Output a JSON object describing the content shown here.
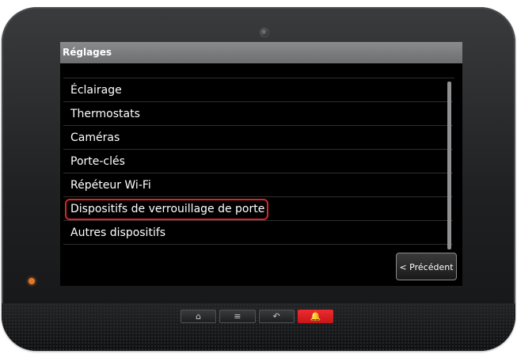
{
  "screen": {
    "title": "Réglages",
    "items": [
      {
        "label": "Éclairage"
      },
      {
        "label": "Thermostats"
      },
      {
        "label": "Caméras"
      },
      {
        "label": "Porte-clés"
      },
      {
        "label": "Répéteur Wi-Fi"
      },
      {
        "label": "Dispositifs de verrouillage de porte",
        "highlighted": true
      },
      {
        "label": "Autres dispositifs"
      }
    ],
    "back_label": "< Précédent"
  },
  "hardware_buttons": [
    {
      "icon": "home-icon",
      "glyph": "⌂"
    },
    {
      "icon": "menu-icon",
      "glyph": "≡"
    },
    {
      "icon": "back-arrow-icon",
      "glyph": "↶"
    },
    {
      "icon": "alarm-icon",
      "glyph": "🔔"
    }
  ],
  "colors": {
    "highlight": "#d8242a",
    "title_bar": "#7b7c7e",
    "alarm": "#e0222a",
    "led": "#e0782a"
  }
}
